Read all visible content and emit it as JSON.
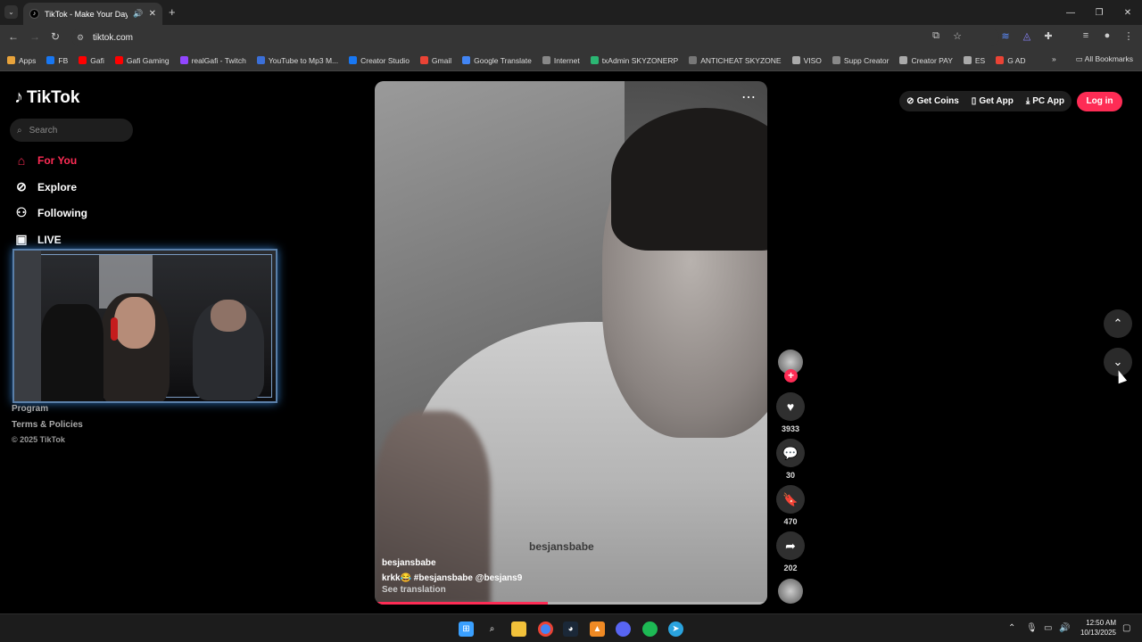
{
  "browser": {
    "tab_title": "TikTok - Make Your Day",
    "url": "tiktok.com",
    "bookmarks": [
      {
        "label": "Apps",
        "color": "#e8a33b"
      },
      {
        "label": "FB",
        "color": "#1877f2"
      },
      {
        "label": "Gafi",
        "color": "#ff0000"
      },
      {
        "label": "Gafi Gaming",
        "color": "#ff0000"
      },
      {
        "label": "realGafi - Twitch",
        "color": "#9146ff"
      },
      {
        "label": "YouTube to Mp3 M...",
        "color": "#3b6fd8"
      },
      {
        "label": "Creator Studio",
        "color": "#1877f2"
      },
      {
        "label": "Gmail",
        "color": "#ea4335"
      },
      {
        "label": "Google Translate",
        "color": "#4285f4"
      },
      {
        "label": "Internet",
        "color": "#888888"
      },
      {
        "label": "txAdmin SKYZONERP",
        "color": "#2bb673"
      },
      {
        "label": "ANTICHEAT SKYZONE",
        "color": "#777777"
      },
      {
        "label": "VISO",
        "color": "#aaaaaa"
      },
      {
        "label": "Supp Creator",
        "color": "#888888"
      },
      {
        "label": "Creator PAY",
        "color": "#aaaaaa"
      },
      {
        "label": "ES",
        "color": "#aaaaaa"
      },
      {
        "label": "G AD",
        "color": "#ea4335"
      }
    ],
    "all_bookmarks": "All Bookmarks"
  },
  "sidebar": {
    "brand": "TikTok",
    "search_placeholder": "Search",
    "menu": [
      {
        "label": "For You",
        "icon": "home-icon"
      },
      {
        "label": "Explore",
        "icon": "compass-icon"
      },
      {
        "label": "Following",
        "icon": "following-icon"
      },
      {
        "label": "LIVE",
        "icon": "live-icon"
      }
    ],
    "footer": {
      "program": "Program",
      "terms": "Terms & Policies",
      "copyright": "© 2025 TikTok"
    }
  },
  "header": {
    "get_coins": "Get Coins",
    "get_app": "Get App",
    "pc_app": "PC App",
    "login": "Log in"
  },
  "video": {
    "watermark": "besjansbabe",
    "username": "besjansbabe",
    "caption": "krkk😂 #besjansbabe  @besjans9",
    "see_translation": "See translation",
    "progress": 0.44
  },
  "actions": {
    "likes": "3933",
    "comments": "30",
    "saves": "470",
    "shares": "202"
  },
  "taskbar": {
    "time": "12:50 AM",
    "date": "10/13/2025"
  },
  "colors": {
    "accent": "#fe2c55",
    "background": "#000000"
  }
}
